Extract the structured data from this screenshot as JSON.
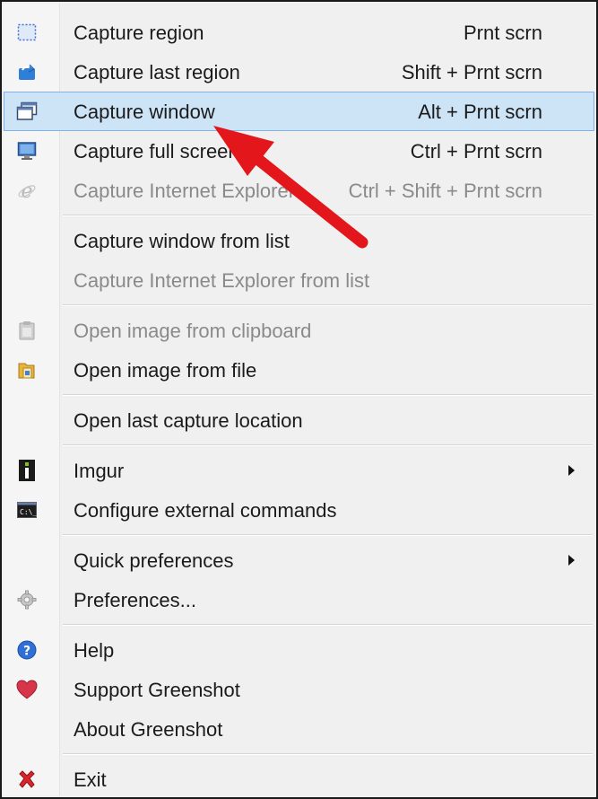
{
  "menu": {
    "items": [
      {
        "label": "Capture region",
        "shortcut": "Prnt scrn",
        "icon": "region-select-icon",
        "disabled": false
      },
      {
        "label": "Capture last region",
        "shortcut": "Shift + Prnt scrn",
        "icon": "refresh-icon",
        "disabled": false
      },
      {
        "label": "Capture window",
        "shortcut": "Alt + Prnt scrn",
        "icon": "window-icon",
        "disabled": false,
        "highlighted": true
      },
      {
        "label": "Capture full screen",
        "shortcut": "Ctrl + Prnt scrn",
        "icon": "monitor-icon",
        "disabled": false
      },
      {
        "label": "Capture Internet Explorer",
        "shortcut": "Ctrl + Shift + Prnt scrn",
        "icon": "ie-icon",
        "disabled": true
      },
      {
        "label": "Capture window from list",
        "shortcut": "",
        "disabled": false
      },
      {
        "label": "Capture Internet Explorer from list",
        "shortcut": "",
        "disabled": true
      },
      {
        "label": "Open image from clipboard",
        "icon": "clipboard-icon",
        "disabled": true
      },
      {
        "label": "Open image from file",
        "icon": "folder-icon",
        "disabled": false
      },
      {
        "label": "Open last capture location",
        "disabled": false
      },
      {
        "label": "Imgur",
        "icon": "imgur-icon",
        "disabled": false,
        "submenu": true
      },
      {
        "label": "Configure external commands",
        "icon": "console-icon",
        "disabled": false
      },
      {
        "label": "Quick preferences",
        "disabled": false,
        "submenu": true
      },
      {
        "label": "Preferences...",
        "icon": "gear-icon",
        "disabled": false
      },
      {
        "label": "Help",
        "icon": "help-icon",
        "disabled": false
      },
      {
        "label": "Support Greenshot",
        "icon": "heart-icon",
        "disabled": false
      },
      {
        "label": "About Greenshot",
        "disabled": false
      },
      {
        "label": "Exit",
        "icon": "exit-icon",
        "disabled": false
      }
    ]
  },
  "colors": {
    "highlight_bg": "#cde4f7",
    "highlight_border": "#7eb4ea",
    "disabled_text": "#8a8a8a",
    "annotation_arrow": "#e3161b"
  },
  "annotation": {
    "type": "arrow",
    "points_to": "Capture window"
  }
}
